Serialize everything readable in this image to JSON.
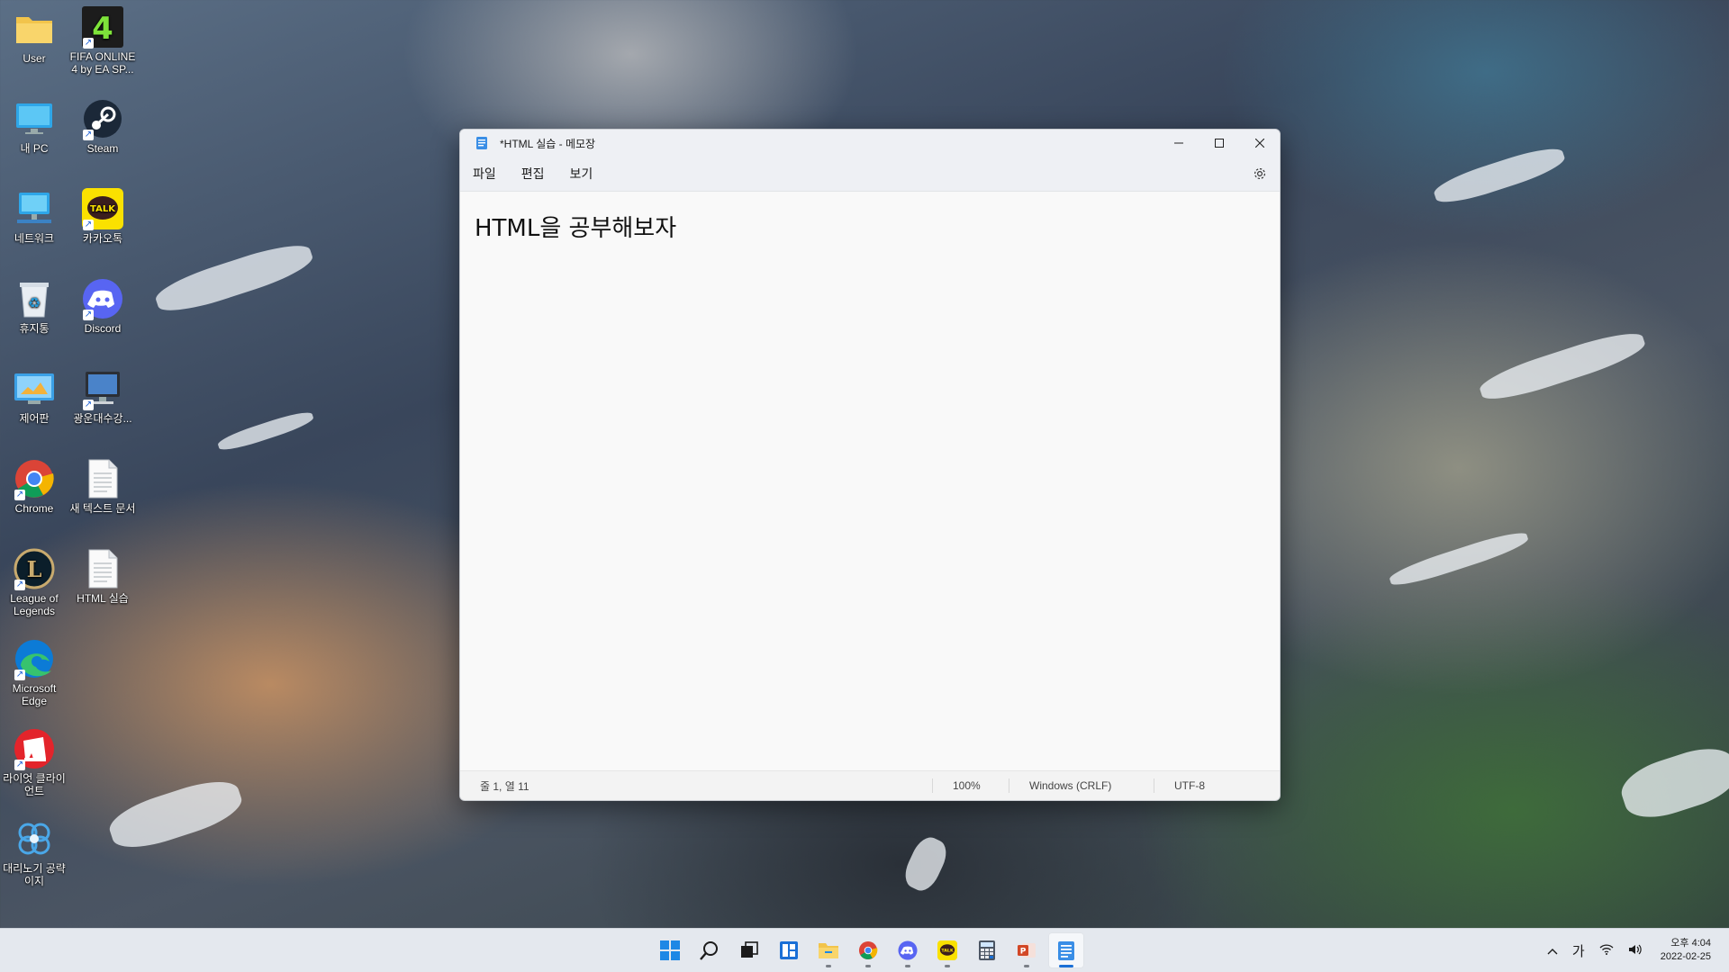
{
  "desktop": {
    "icons": [
      {
        "label": "User",
        "icon": "folder-icon"
      },
      {
        "label": "FIFA ONLINE 4 by EA SP...",
        "icon": "fifa-icon"
      },
      {
        "label": "내 PC",
        "icon": "monitor-icon"
      },
      {
        "label": "Steam",
        "icon": "steam-icon"
      },
      {
        "label": "네트워크",
        "icon": "network-icon"
      },
      {
        "label": "카카오톡",
        "icon": "kakaotalk-icon"
      },
      {
        "label": "휴지통",
        "icon": "recycle-bin-icon"
      },
      {
        "label": "Discord",
        "icon": "discord-icon"
      },
      {
        "label": "제어판",
        "icon": "control-panel-icon"
      },
      {
        "label": "광운대수강...",
        "icon": "remote-desktop-icon"
      },
      {
        "label": "Chrome",
        "icon": "chrome-icon"
      },
      {
        "label": "새 텍스트 문서",
        "icon": "text-document-icon"
      },
      {
        "label": "League of Legends",
        "icon": "league-of-legends-icon"
      },
      {
        "label": "HTML 실습",
        "icon": "text-document-icon"
      },
      {
        "label": "Microsoft Edge",
        "icon": "edge-icon"
      },
      {
        "label": "라이엇 클라이언트",
        "icon": "riot-client-icon"
      },
      {
        "label": "대리노기 공략이지",
        "icon": "web-shortcut-icon"
      }
    ]
  },
  "window": {
    "title": "*HTML 실습 - 메모장",
    "menu": [
      "파일",
      "편집",
      "보기"
    ],
    "content": "HTML을 공부해보자",
    "status": {
      "position": "줄 1, 열 11",
      "zoom": "100%",
      "line_ending": "Windows (CRLF)",
      "encoding": "UTF-8"
    }
  },
  "taskbar": {
    "apps": [
      "start-icon",
      "search-icon",
      "task-view-icon",
      "widgets-icon",
      "file-explorer-icon",
      "chrome-icon",
      "discord-icon",
      "kakaotalk-icon",
      "calculator-icon",
      "powerpoint-icon",
      "notepad-icon"
    ],
    "tray": {
      "ime": "가",
      "time": "오후 4:04",
      "date": "2022-02-25"
    }
  },
  "colors": {
    "accent": "#1a6fd6",
    "taskbar_bg": "#e4e8ee",
    "window_bg": "#f9f9f9"
  }
}
